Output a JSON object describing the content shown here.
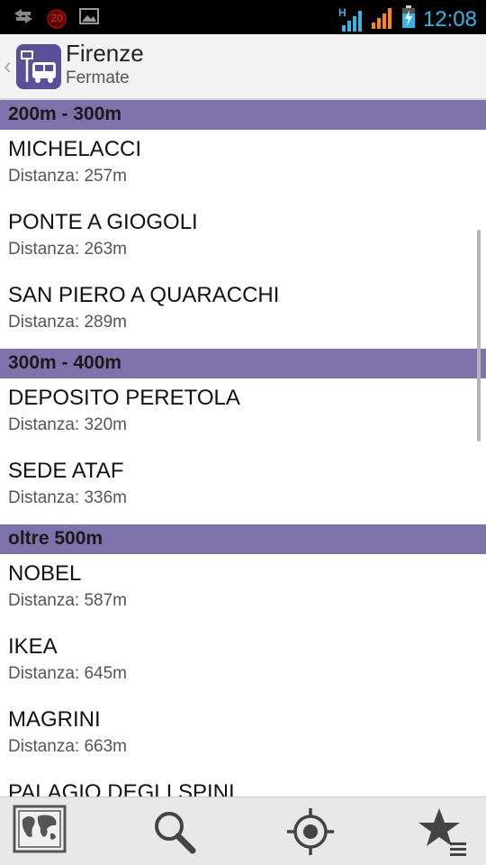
{
  "status_bar": {
    "time": "12:08",
    "network_badge": "H",
    "notification_count": "20",
    "icons": [
      "data-transfer-icon",
      "notification-badge-icon",
      "image-icon",
      "signal-h-icon",
      "signal-icon",
      "battery-charging-icon"
    ]
  },
  "header": {
    "title": "Firenze",
    "subtitle": "Fermate",
    "app_icon": "bus-stop-icon"
  },
  "sections": [
    {
      "title": "200m - 300m",
      "items": [
        {
          "name": "MICHELACCI",
          "distance": "Distanza: 257m"
        },
        {
          "name": "PONTE A GIOGOLI",
          "distance": "Distanza: 263m"
        },
        {
          "name": "SAN PIERO A QUARACCHI",
          "distance": "Distanza: 289m"
        }
      ]
    },
    {
      "title": "300m - 400m",
      "items": [
        {
          "name": "DEPOSITO PERETOLA",
          "distance": "Distanza: 320m"
        },
        {
          "name": "SEDE ATAF",
          "distance": "Distanza: 336m"
        }
      ]
    },
    {
      "title": "oltre 500m",
      "items": [
        {
          "name": "NOBEL",
          "distance": "Distanza: 587m"
        },
        {
          "name": "IKEA",
          "distance": "Distanza: 645m"
        },
        {
          "name": "MAGRINI",
          "distance": "Distanza: 663m"
        },
        {
          "name": "PALAGIO DEGLI SPINI",
          "distance": ""
        }
      ]
    }
  ],
  "bottom_bar": {
    "items": [
      "map-icon",
      "search-icon",
      "locate-icon",
      "favorites-icon"
    ]
  },
  "colors": {
    "section_header": "#7e72ad",
    "clock": "#33b5e5",
    "app_icon_bg": "#5b4f9a"
  }
}
